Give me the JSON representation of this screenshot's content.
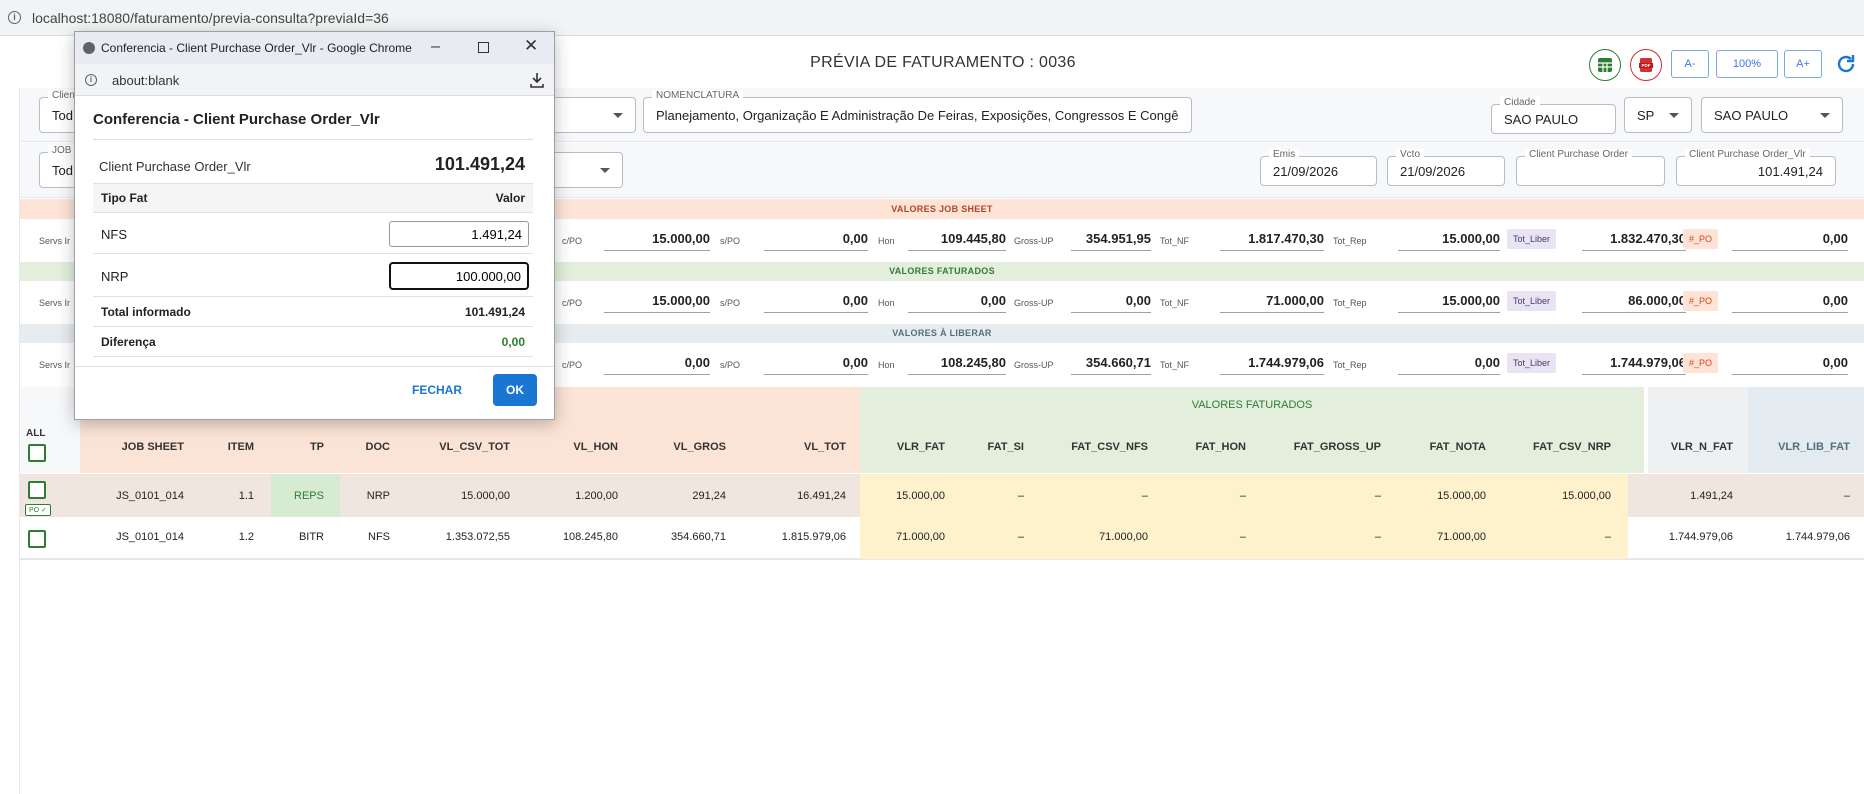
{
  "browser": {
    "url": "localhost:18080/faturamento/previa-consulta?previaId=36"
  },
  "page": {
    "title": "PRÉVIA DE FATURAMENTO : 0036"
  },
  "toolbar": {
    "font_minus": "A-",
    "zoom": "100%",
    "font_plus": "A+",
    "excel_icon": "spreadsheet-icon",
    "pdf_icon": "pdf-icon",
    "refresh_icon": "refresh-icon"
  },
  "filters": {
    "client_label": "Clien",
    "client_value": "Tod",
    "job_label": "JOB S",
    "job_value": "Tod",
    "nomenclatura_label": "NOMENCLATURA",
    "nomenclatura_value": "Planejamento, Organização E Administração De Feiras, Exposições, Congressos E Congênere",
    "cidade_label": "Cidade",
    "cidade_value": "SAO PAULO",
    "uf_value": "SP",
    "municipio_value": "SAO PAULO",
    "emis_label": "Emis",
    "emis_value": "21/09/2026",
    "vcto_label": "Vcto",
    "vcto_value": "21/09/2026",
    "cpo_label": "Client Purchase Order",
    "cpo_value": "",
    "cpo_vlr_label": "Client Purchase Order_Vlr",
    "cpo_vlr_value": "101.491,24"
  },
  "sections": [
    {
      "title": "VALORES JOB SHEET",
      "servs": "Servs Ir",
      "cpo": "15.000,00",
      "spo": "0,00",
      "hon": "109.445,80",
      "gross": "354.951,95",
      "tot_nf": "1.817.470,30",
      "tot_rep": "15.000,00",
      "tot_liber": "1.832.470,30",
      "npo": "0,00"
    },
    {
      "title": "VALORES FATURADOS",
      "servs": "Servs Ir",
      "cpo": "15.000,00",
      "spo": "0,00",
      "hon": "0,00",
      "gross": "0,00",
      "tot_nf": "71.000,00",
      "tot_rep": "15.000,00",
      "tot_liber": "86.000,00",
      "npo": "0,00"
    },
    {
      "title": "VALORES À LIBERAR",
      "servs": "Servs Ir",
      "cpo": "0,00",
      "spo": "0,00",
      "hon": "108.245,80",
      "gross": "354.660,71",
      "tot_nf": "1.744.979,06",
      "tot_rep": "0,00",
      "tot_liber": "1.744.979,06",
      "npo": "0,00"
    }
  ],
  "value_labels": {
    "cpo": "c/PO",
    "spo": "s/PO",
    "hon": "Hon",
    "gross": "Gross-UP",
    "tot_nf": "Tot_NF",
    "tot_rep": "Tot_Rep",
    "tot_liber": "Tot_Liber",
    "npo": "#_PO"
  },
  "table": {
    "all_label": "ALL",
    "group_faturados": "VALORES FATURADOS",
    "columns": [
      "JOB SHEET",
      "ITEM",
      "TP",
      "DOC",
      "VL_CSV_TOT",
      "VL_HON",
      "VL_GROS",
      "VL_TOT",
      "VLR_FAT",
      "FAT_SI",
      "FAT_CSV_NFS",
      "FAT_HON",
      "FAT_GROSS_UP",
      "FAT_NOTA",
      "FAT_CSV_NRP",
      "VLR_N_FAT",
      "VLR_LIB_FAT"
    ],
    "rows": [
      {
        "po_badge": "PO ✓",
        "cells": [
          "JS_0101_014",
          "1.1",
          "REPS",
          "NRP",
          "15.000,00",
          "1.200,00",
          "291,24",
          "16.491,24",
          "15.000,00",
          "–",
          "–",
          "–",
          "–",
          "15.000,00",
          "15.000,00",
          "1.491,24",
          "–"
        ]
      },
      {
        "po_badge": "",
        "cells": [
          "JS_0101_014",
          "1.2",
          "BITR",
          "NFS",
          "1.353.072,55",
          "108.245,80",
          "354.660,71",
          "1.815.979,06",
          "71.000,00",
          "–",
          "71.000,00",
          "–",
          "–",
          "71.000,00",
          "–",
          "1.744.979,06",
          "1.744.979,06"
        ]
      }
    ]
  },
  "popup": {
    "window_title": "Conferencia - Client Purchase Order_Vlr - Google Chrome",
    "address": "about:blank",
    "heading": "Conferencia - Client Purchase Order_Vlr",
    "cpo_label": "Client Purchase Order_Vlr",
    "cpo_value": "101.491,24",
    "col_tipo": "Tipo Fat",
    "col_valor": "Valor",
    "nfs_label": "NFS",
    "nfs_value": "1.491,24",
    "nrp_label": "NRP",
    "nrp_value": "100.000,00",
    "total_label": "Total informado",
    "total_value": "101.491,24",
    "diff_label": "Diferença",
    "diff_value": "0,00",
    "fechar": "FECHAR",
    "ok": "OK"
  },
  "colors": {
    "accent": "#1976d2",
    "green": "#2e7d32",
    "jobsheet_bg": "#fde4d6",
    "faturados_bg": "#e3efdc",
    "liberar_bg": "#e6ecef",
    "yellow_cell": "#fdf2cc"
  }
}
